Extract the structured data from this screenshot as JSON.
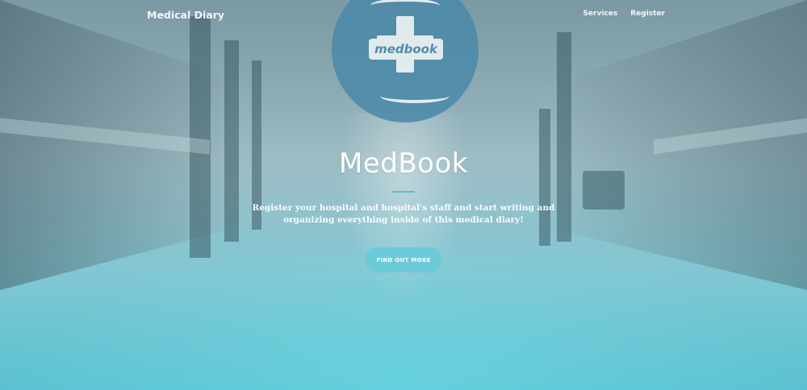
{
  "navbar": {
    "brand": "Medical Diary",
    "links": [
      {
        "label": "Services"
      },
      {
        "label": "Register"
      }
    ]
  },
  "logo": {
    "text": "medbook"
  },
  "hero": {
    "title": "MedBook",
    "subtitle": "Register your hospital and hospital's staff and start writing and organizing everything inside of this medical diary!",
    "cta_label": "FIND OUT MORE"
  },
  "colors": {
    "accent": "#6ccbd9",
    "logo_blue": "#4d8aa9",
    "text": "#ffffff"
  }
}
